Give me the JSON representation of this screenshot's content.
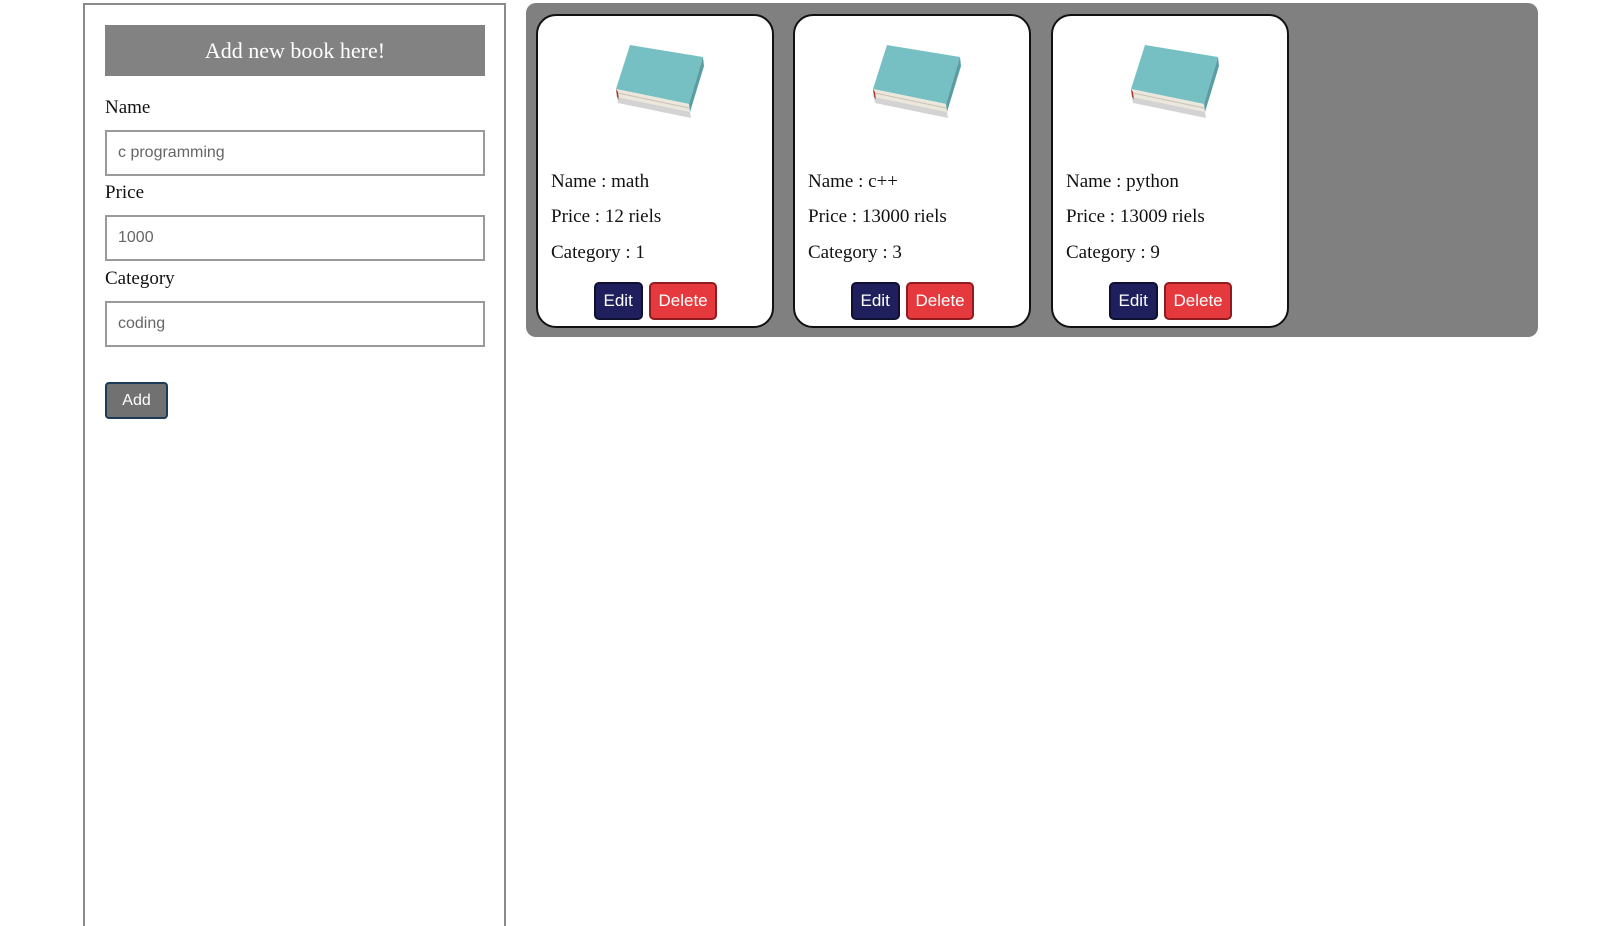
{
  "form": {
    "header": "Add new book here!",
    "name_label": "Name",
    "name_placeholder": "c programming",
    "price_label": "Price",
    "price_placeholder": "1000",
    "category_label": "Category",
    "category_placeholder": "coding",
    "add_button": "Add"
  },
  "books": [
    {
      "name": "Name : math",
      "price": "Price : 12 riels",
      "category": "Category : 1",
      "edit_label": "Edit",
      "delete_label": "Delete",
      "image_icon": "book-icon"
    },
    {
      "name": "Name : c++",
      "price": "Price : 13000 riels",
      "category": "Category : 3",
      "edit_label": "Edit",
      "delete_label": "Delete",
      "image_icon": "book-icon"
    },
    {
      "name": "Name : python",
      "price": "Price : 13009 riels",
      "category": "Category : 9",
      "edit_label": "Edit",
      "delete_label": "Delete",
      "image_icon": "book-icon"
    }
  ],
  "colors": {
    "panel_header_bg": "#828282",
    "list_bg": "#808080",
    "edit_button": "#1f1f5e",
    "delete_button": "#e5393d",
    "book_cover": "#6fb8bc"
  }
}
